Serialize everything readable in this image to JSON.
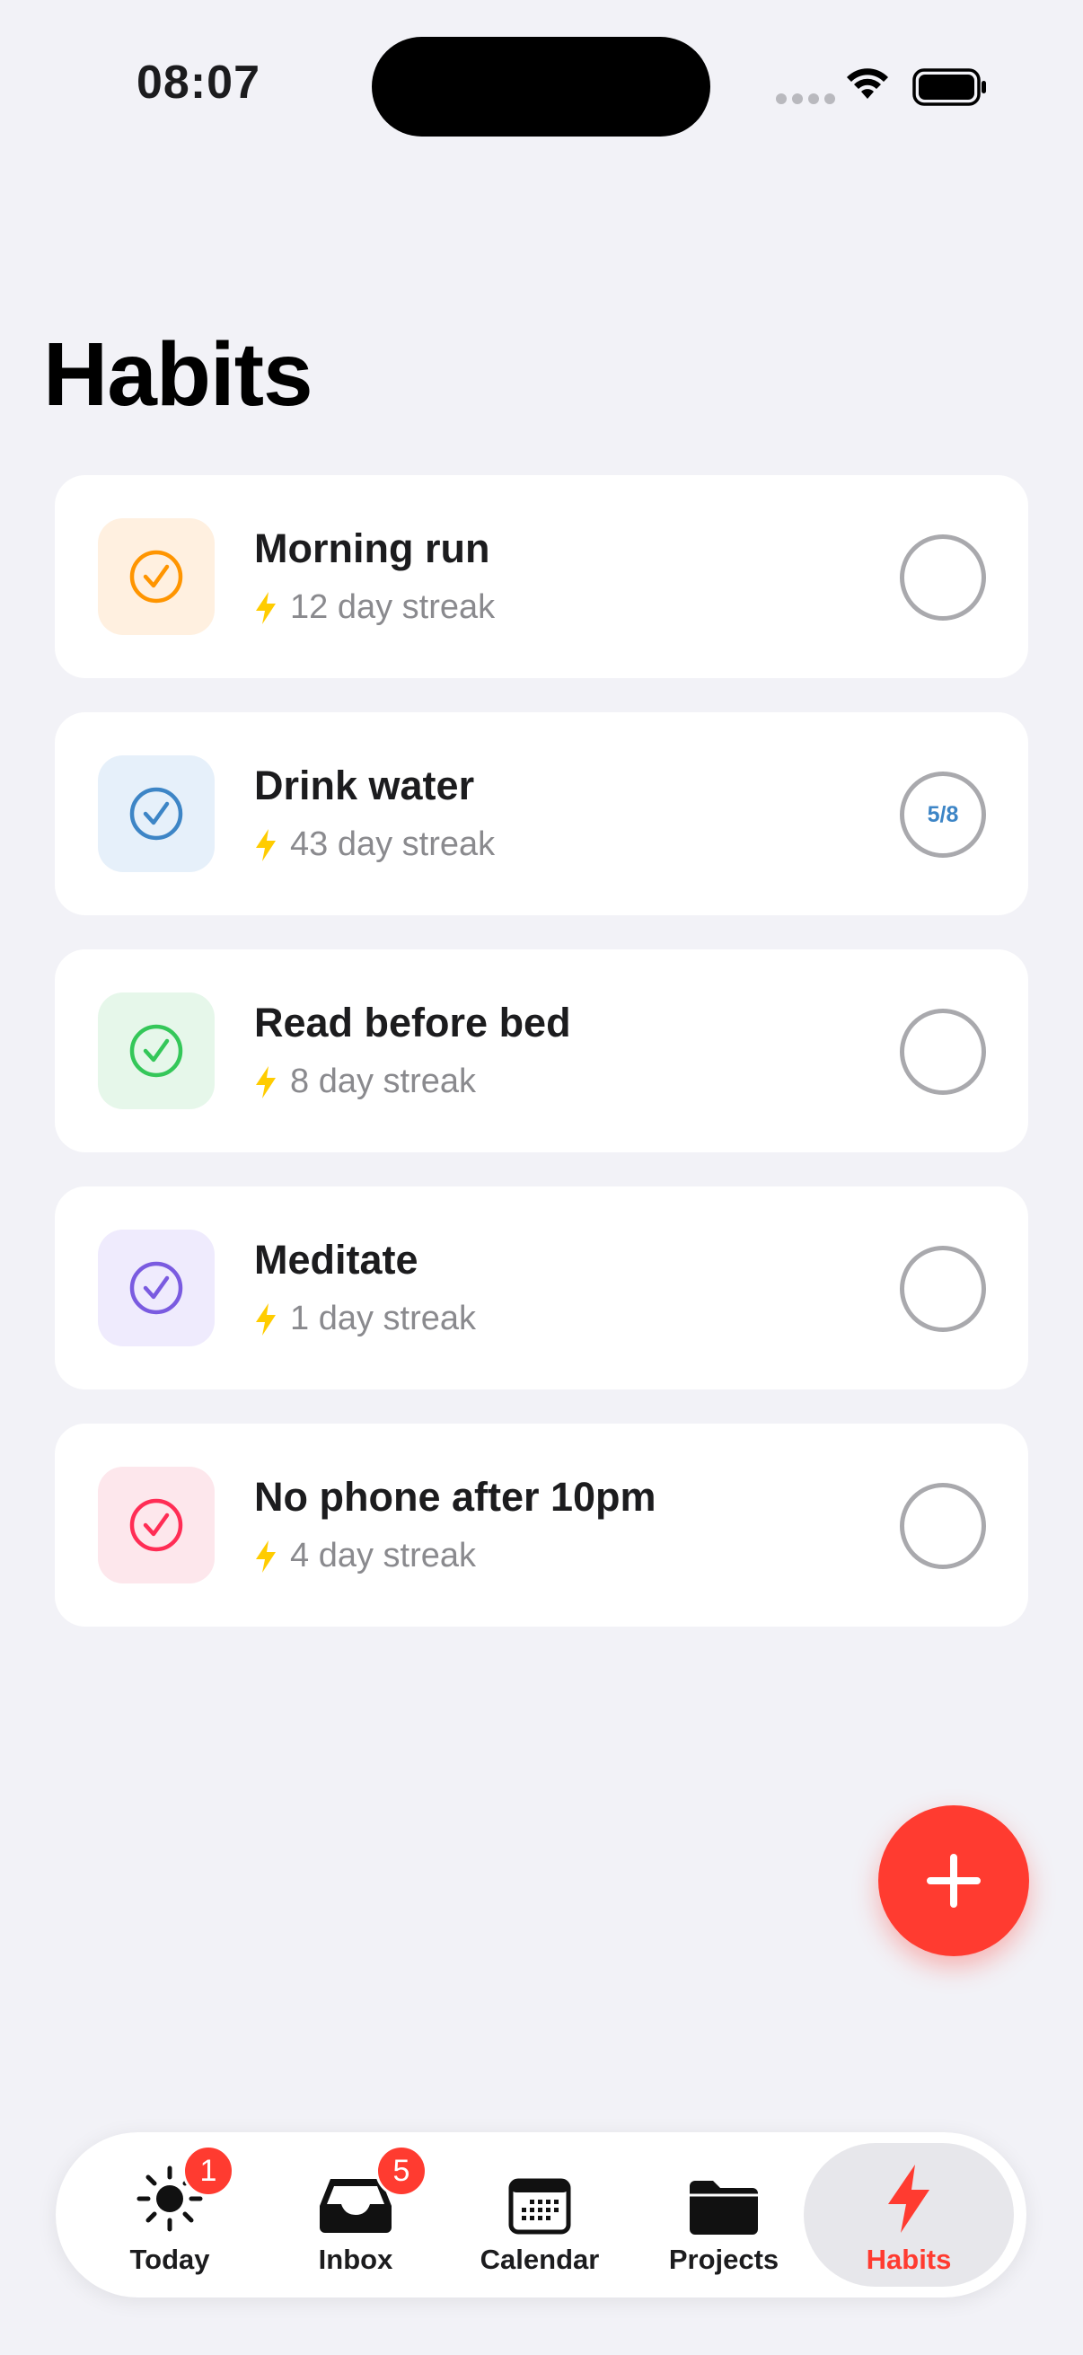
{
  "status_bar": {
    "time": "08:07"
  },
  "page": {
    "title": "Habits"
  },
  "habits": [
    {
      "name": "Morning run",
      "streak": "12 day streak",
      "color": "#ff9500",
      "tile_color": "#fff0e0",
      "progress": ""
    },
    {
      "name": "Drink water",
      "streak": "43 day streak",
      "color": "#3d85c6",
      "tile_color": "#e6f0fa",
      "progress": "5/8"
    },
    {
      "name": "Read before bed",
      "streak": "8 day streak",
      "color": "#34c759",
      "tile_color": "#e6f7ea",
      "progress": ""
    },
    {
      "name": "Meditate",
      "streak": "1 day streak",
      "color": "#7a5be0",
      "tile_color": "#efebfd",
      "progress": ""
    },
    {
      "name": "No phone after 10pm",
      "streak": "4 day streak",
      "color": "#ff2d55",
      "tile_color": "#fde7ec",
      "progress": ""
    }
  ],
  "fab": {
    "icon": "plus-icon",
    "color": "#ff3b30"
  },
  "tab_bar": {
    "tabs": [
      {
        "label": "Today",
        "icon": "sun-icon",
        "badge": "1"
      },
      {
        "label": "Inbox",
        "icon": "inbox-tray-icon",
        "badge": "5"
      },
      {
        "label": "Calendar",
        "icon": "calendar-icon",
        "badge": ""
      },
      {
        "label": "Projects",
        "icon": "folder-icon",
        "badge": ""
      },
      {
        "label": "Habits",
        "icon": "bolt-icon",
        "badge": "",
        "active": true
      }
    ],
    "accent_color": "#ff3b30"
  },
  "streak_icon_color": "#ffcc00"
}
